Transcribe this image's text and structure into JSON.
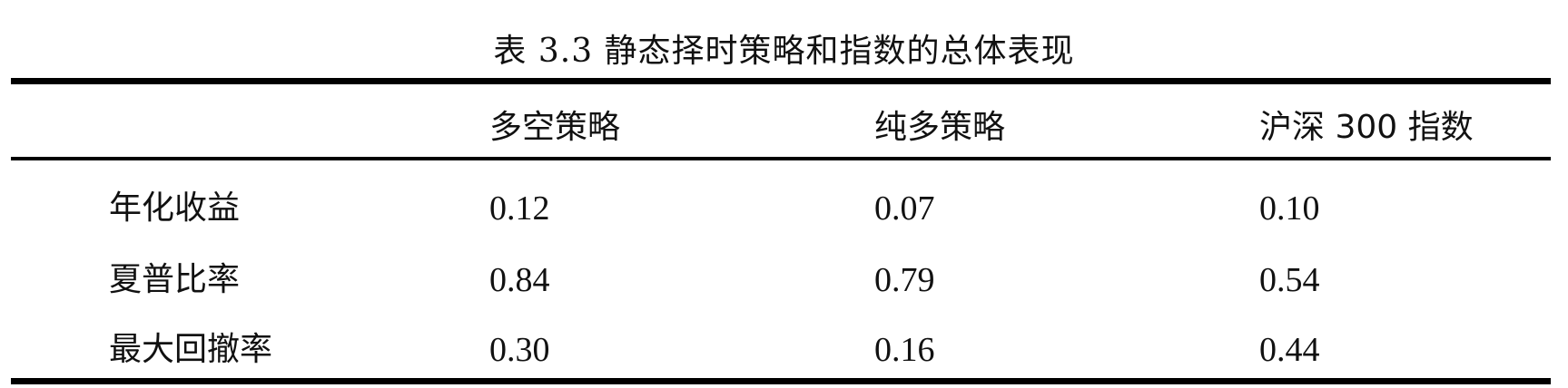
{
  "caption": "表 3.3  静态择时策略和指数的总体表现",
  "table": {
    "headers": [
      "",
      "多空策略",
      "纯多策略",
      "沪深 300 指数"
    ],
    "rows": [
      [
        "年化收益",
        "0.12",
        "0.07",
        "0.10"
      ],
      [
        "夏普比率",
        "0.84",
        "0.79",
        "0.54"
      ],
      [
        "最大回撤率",
        "0.30",
        "0.16",
        "0.44"
      ]
    ]
  }
}
